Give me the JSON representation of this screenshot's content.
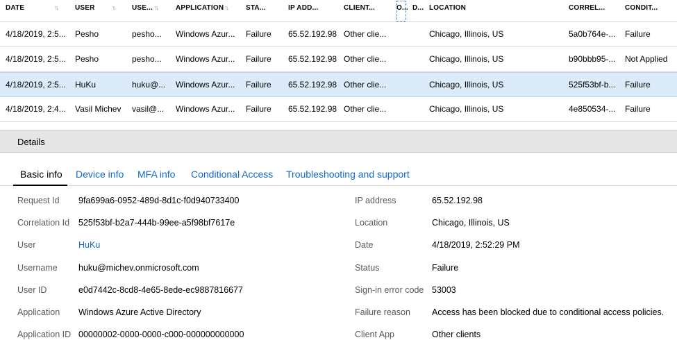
{
  "table": {
    "columns": [
      {
        "label": "DATE",
        "sort": true
      },
      {
        "label": "USER",
        "sort": true
      },
      {
        "label": "USE...",
        "sort": true
      },
      {
        "label": "APPLICATION",
        "sort": true
      },
      {
        "label": "STA...",
        "sort": false
      },
      {
        "label": "IP ADD...",
        "sort": false
      },
      {
        "label": "CLIENT...",
        "sort": false
      },
      {
        "label": "O...",
        "sort": false
      },
      {
        "label": "D...",
        "sort": false
      },
      {
        "label": "LOCATION",
        "sort": false
      },
      {
        "label": "CORREL...",
        "sort": false
      },
      {
        "label": "CONDIT...",
        "sort": false
      }
    ],
    "sort_glyph": "↑↓",
    "rows": [
      {
        "date": "4/18/2019, 2:5...",
        "user": "Pesho",
        "username": "pesho...",
        "application": "Windows Azur...",
        "status": "Failure",
        "ip": "65.52.192.98",
        "client": "Other clie...",
        "os": "",
        "device": "",
        "location": "Chicago, Illinois, US",
        "correlation": "5a0b764e-...",
        "conditional": "Failure",
        "selected": false
      },
      {
        "date": "4/18/2019, 2:5...",
        "user": "Pesho",
        "username": "pesho...",
        "application": "Windows Azur...",
        "status": "Failure",
        "ip": "65.52.192.98",
        "client": "Other clie...",
        "os": "",
        "device": "",
        "location": "Chicago, Illinois, US",
        "correlation": "b90bbb95-...",
        "conditional": "Not Applied",
        "selected": false
      },
      {
        "date": "4/18/2019, 2:5...",
        "user": "HuKu",
        "username": "huku@...",
        "application": "Windows Azur...",
        "status": "Failure",
        "ip": "65.52.192.98",
        "client": "Other clie...",
        "os": "",
        "device": "",
        "location": "Chicago, Illinois, US",
        "correlation": "525f53bf-b...",
        "conditional": "Failure",
        "selected": true
      },
      {
        "date": "4/18/2019, 2:4...",
        "user": "Vasil Michev",
        "username": "vasil@...",
        "application": "Windows Azur...",
        "status": "Failure",
        "ip": "65.52.192.98",
        "client": "Other clie...",
        "os": "",
        "device": "",
        "location": "Chicago, Illinois, US",
        "correlation": "4e850534-...",
        "conditional": "Failure",
        "selected": false
      }
    ]
  },
  "details": {
    "title": "Details",
    "tabs": [
      "Basic info",
      "Device info",
      "MFA info",
      "Conditional Access",
      "Troubleshooting and support"
    ],
    "active_tab": 0,
    "left": [
      {
        "label": "Request Id",
        "value": "9fa699a6-0952-489d-8d1c-f0d940733400",
        "link": false
      },
      {
        "label": "Correlation Id",
        "value": "525f53bf-b2a7-444b-99ee-a5f98bf7617e",
        "link": false
      },
      {
        "label": "User",
        "value": "HuKu",
        "link": true
      },
      {
        "label": "Username",
        "value": "huku@michev.onmicrosoft.com",
        "link": false
      },
      {
        "label": "User ID",
        "value": "e0d7442c-8cd8-4e65-8ede-ec9887816677",
        "link": false
      },
      {
        "label": "Application",
        "value": "Windows Azure Active Directory",
        "link": false
      },
      {
        "label": "Application ID",
        "value": "00000002-0000-0000-c000-000000000000",
        "link": false
      }
    ],
    "right": [
      {
        "label": "IP address",
        "value": "65.52.192.98"
      },
      {
        "label": "Location",
        "value": "Chicago, Illinois, US"
      },
      {
        "label": "Date",
        "value": "4/18/2019, 2:52:29 PM"
      },
      {
        "label": "Status",
        "value": "Failure"
      },
      {
        "label": "Sign-in error code",
        "value": "53003"
      },
      {
        "label": "Failure reason",
        "value": "Access has been blocked due to conditional access policies."
      },
      {
        "label": "Client App",
        "value": "Other clients"
      }
    ]
  }
}
